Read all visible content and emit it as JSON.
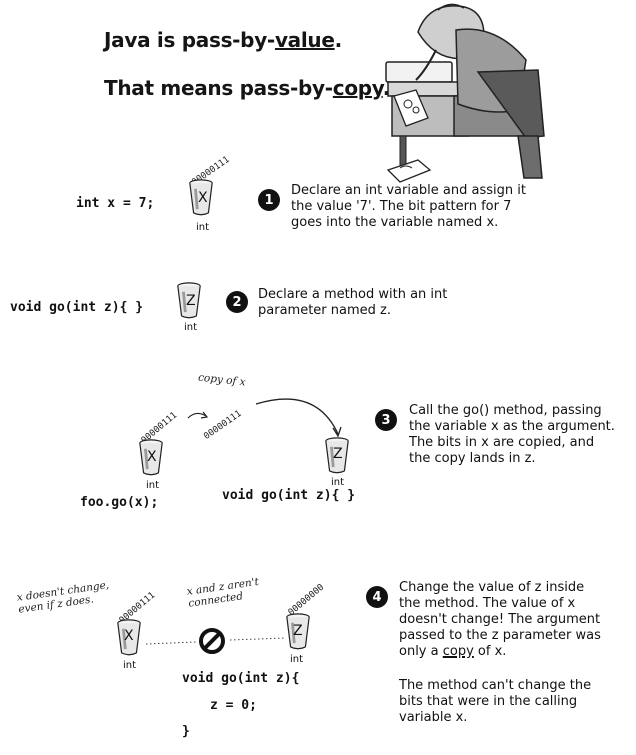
{
  "header": {
    "title_prefix": "Java is pass-by-",
    "title_emph": "value",
    "title_suffix": ".",
    "subtitle_prefix": "That means pass-by-",
    "subtitle_emph": "copy",
    "subtitle_suffix": "."
  },
  "step1": {
    "number": "1",
    "code": "int x = 7;",
    "cup_letter": "X",
    "cup_type": "int",
    "bits": "00000111",
    "desc_line1": "Declare an int variable and assign it",
    "desc_line2": "the value '7'. The bit pattern for 7",
    "desc_line3": "goes into the variable named x."
  },
  "step2": {
    "number": "2",
    "code": "void go(int z){ }",
    "cup_letter": "Z",
    "cup_type": "int",
    "desc_line1": "Declare a method with an int",
    "desc_line2": "parameter named z."
  },
  "step3": {
    "number": "3",
    "annotation": "copy of x",
    "bits_left": "00000111",
    "bits_mid": "00000111",
    "cup_x_letter": "X",
    "cup_x_type": "int",
    "cup_z_letter": "Z",
    "cup_z_type": "int",
    "code_call": "foo.go(x);",
    "code_method": "void go(int z){ }",
    "desc_line1": "Call the go() method, passing",
    "desc_line2": "the variable x as the argument.",
    "desc_line3": "The bits in x are copied, and",
    "desc_line4": "the copy lands in z."
  },
  "step4": {
    "number": "4",
    "annotation_left_1": "x doesn't change,",
    "annotation_left_2": "even if z does.",
    "annotation_mid_1": "x and z aren't",
    "annotation_mid_2": "connected",
    "bits_x": "00000111",
    "bits_z": "00000000",
    "cup_x_letter": "X",
    "cup_x_type": "int",
    "cup_z_letter": "Z",
    "cup_z_type": "int",
    "code_line1": "void go(int z){",
    "code_line2": "z = 0;",
    "code_line3": "}",
    "desc_line1": "Change the value of z inside",
    "desc_line2": "the method. The value of x",
    "desc_line3": "doesn't change! The argument",
    "desc_line4": "passed to the z parameter was",
    "desc_line5_prefix": "only a ",
    "desc_line5_emph": "copy",
    "desc_line5_suffix": " of x.",
    "desc2_line1": "The method can't change the",
    "desc2_line2": "bits that were in the calling",
    "desc2_line3": "variable x."
  },
  "colors": {
    "ink": "#111111",
    "cup_fill": "#e8e8e8",
    "paper": "#ffffff"
  },
  "icons": [
    "copy-machine-illustration",
    "no-connection-icon",
    "curved-arrow-icon"
  ]
}
